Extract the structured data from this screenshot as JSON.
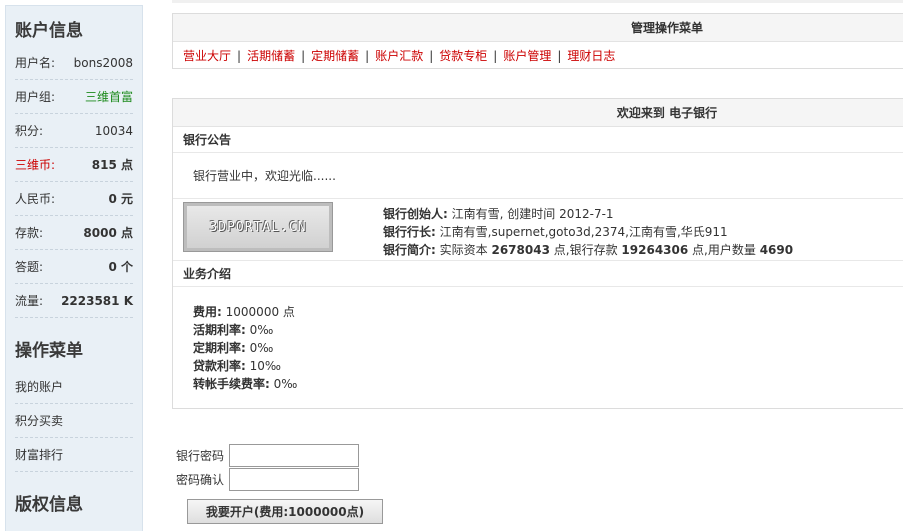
{
  "sidebar": {
    "account_title": "账户信息",
    "rows": [
      {
        "label": "用户名:",
        "value": "bons2008"
      },
      {
        "label": "用户组:",
        "value": "三维首富"
      },
      {
        "label": "积分:",
        "value": "10034"
      },
      {
        "label": "三维币:",
        "value": "815 点"
      },
      {
        "label": "人民币:",
        "value": "0 元"
      },
      {
        "label": "存款:",
        "value": "8000 点"
      },
      {
        "label": "答题:",
        "value": "0 个"
      },
      {
        "label": "流量:",
        "value": "2223581 K"
      }
    ],
    "menu_title": "操作菜单",
    "menu": [
      "我的账户",
      "积分买卖",
      "财富排行"
    ],
    "copyright_title": "版权信息"
  },
  "menu_panel": {
    "title": "管理操作菜单",
    "links": [
      "营业大厅",
      "活期储蓄",
      "定期储蓄",
      "账户汇款",
      "贷款专柜",
      "账户管理",
      "理财日志"
    ]
  },
  "welcome_panel": {
    "title": "欢迎来到 电子银行",
    "notice_title": "银行公告",
    "notice_text": "银行营业中，欢迎光临......",
    "logo_text": "3DPORTAL.CN",
    "founder_label": "银行创始人:",
    "founder_value": "江南有雪, 创建时间 2012-7-1",
    "managers_label": "银行行长:",
    "managers_value": "江南有雪,supernet,goto3d,2374,江南有雪,华氏911",
    "intro_label": "银行简介:",
    "intro_capital_label": "实际资本",
    "intro_capital": "2678043",
    "intro_deposit_label": "点,银行存款",
    "intro_deposit": "19264306",
    "intro_users_label": "点,用户数量",
    "intro_users": "4690",
    "biz_title": "业务介绍",
    "biz": [
      {
        "label": "费用:",
        "value": "1000000 点"
      },
      {
        "label": "活期利率:",
        "value": "0‰"
      },
      {
        "label": "定期利率:",
        "value": "0‰"
      },
      {
        "label": "贷款利率:",
        "value": "10‰"
      },
      {
        "label": "转帐手续费率:",
        "value": "0‰"
      }
    ]
  },
  "form": {
    "password_label": "银行密码",
    "confirm_label": "密码确认",
    "submit_label": "我要开户(费用:1000000点)"
  }
}
